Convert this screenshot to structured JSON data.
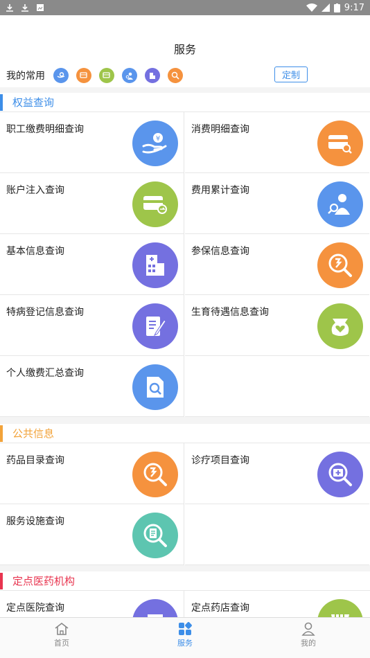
{
  "status": {
    "time": "9:17",
    "battery_text": "B"
  },
  "header": {
    "title": "服务"
  },
  "favorites": {
    "label": "我的常用",
    "custom_label": "定制"
  },
  "sections": [
    {
      "title": "权益查询",
      "color": "#3d8ee8",
      "items": [
        "职工缴费明细查询",
        "消费明细查询",
        "账户注入查询",
        "费用累计查询",
        "基本信息查询",
        "参保信息查询",
        "特病登记信息查询",
        "生育待遇信息查询",
        "个人缴费汇总查询"
      ]
    },
    {
      "title": "公共信息",
      "color": "#f2a33a",
      "items": [
        "药品目录查询",
        "诊疗项目查询",
        "服务设施查询"
      ]
    },
    {
      "title": "定点医药机构",
      "color": "#e8344f",
      "items": [
        "定点医院查询",
        "定点药店查询"
      ]
    }
  ],
  "tabs": {
    "home": "首页",
    "service": "服务",
    "mine": "我的"
  },
  "colors": {
    "blue": "#5a95ec",
    "orange": "#f5923e",
    "green": "#9ec54a",
    "purple": "#7470e0",
    "teal": "#5dc5b0"
  }
}
